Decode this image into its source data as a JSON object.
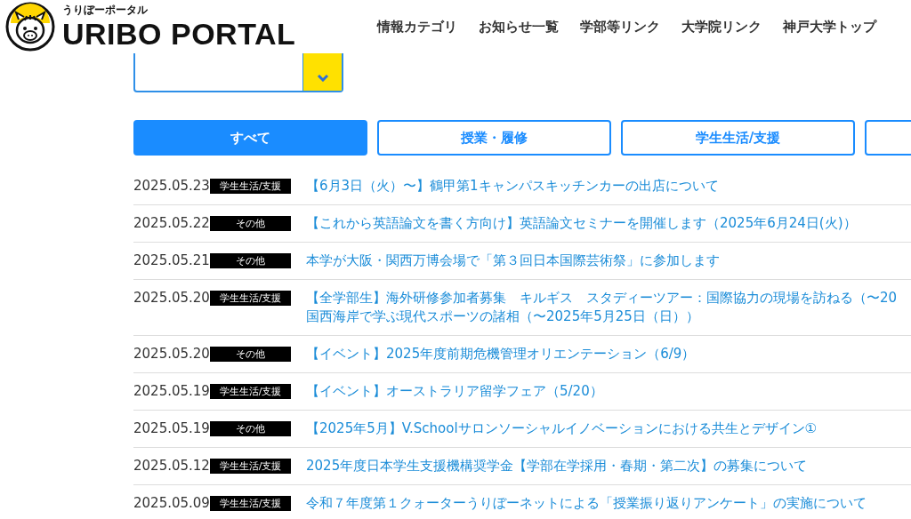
{
  "header": {
    "logo_kana": "うりぼーポータル",
    "logo_title": "URIBO PORTAL",
    "nav": [
      "情報カテゴリ",
      "お知らせ一覧",
      "学部等リンク",
      "大学院リンク",
      "神戸大学トップ"
    ]
  },
  "archive_select": {
    "kind": "select"
  },
  "tabs": [
    {
      "label": "すべて",
      "selected": true
    },
    {
      "label": "授業・履修",
      "selected": false
    },
    {
      "label": "学生生活/支援",
      "selected": false
    },
    {
      "selected": false
    }
  ],
  "news": [
    {
      "date": "2025.05.23",
      "category": "学生生活/支援",
      "title": "【6月3日（火）〜】鶴甲第1キャンパスキッチンカーの出店について"
    },
    {
      "date": "2025.05.22",
      "category": "その他",
      "title": "【これから英語論文を書く方向け】英語論文セミナーを開催します（2025年6月24日(火)）"
    },
    {
      "date": "2025.05.21",
      "category": "その他",
      "title": "本学が大阪・関西万博会場で「第３回日本国際芸術祭」に参加します"
    },
    {
      "date": "2025.05.20",
      "category": "学生生活/支援",
      "title": "【全学部生】海外研修参加者募集　キルギス　スタディーツアー：国際協力の現場を訪ねる（〜20\n国西海岸で学ぶ現代スポーツの諸相（〜2025年5月25日（日））"
    },
    {
      "date": "2025.05.20",
      "category": "その他",
      "title": "【イベント】2025年度前期危機管理オリエンテーション（6/9）"
    },
    {
      "date": "2025.05.19",
      "category": "学生生活/支援",
      "title": "【イベント】オーストラリア留学フェア（5/20）"
    },
    {
      "date": "2025.05.19",
      "category": "その他",
      "title": "【2025年5月】V.Schoolサロンソーシャルイノベーションにおける共生とデザイン①"
    },
    {
      "date": "2025.05.12",
      "category": "学生生活/支援",
      "title": "2025年度日本学生支援機構奨学金【学部在学採用・春期・第二次】の募集について"
    },
    {
      "date": "2025.05.09",
      "category": "学生生活/支援",
      "title": "令和７年度第１クォーターうりぼーネットによる「授業振り返りアンケート」の実施について"
    }
  ]
}
